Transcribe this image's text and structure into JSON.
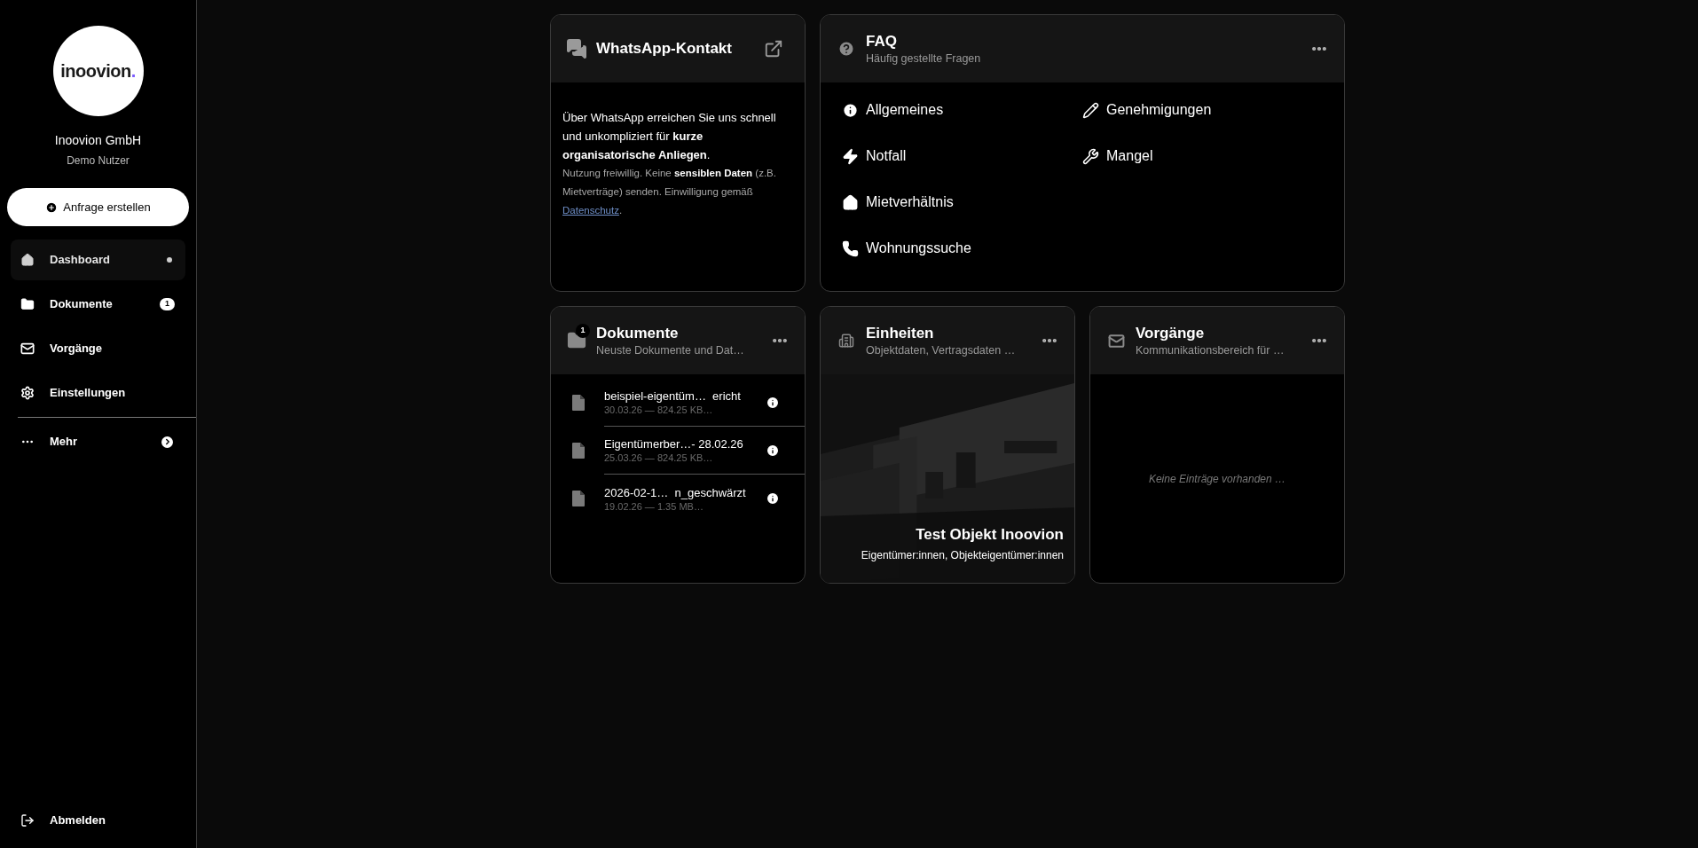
{
  "sidebar": {
    "logo": {
      "text": "inoovion",
      "mark": "."
    },
    "company": "Inoovion GmbH",
    "user": "Demo Nutzer",
    "create_button": "Anfrage erstellen",
    "nav": [
      {
        "kind": "home",
        "label": "Dashboard",
        "selected": true
      },
      {
        "kind": "folder",
        "label": "Dokumente",
        "selected": false,
        "badge": "1"
      },
      {
        "kind": "mail",
        "label": "Vorgänge",
        "selected": false
      },
      {
        "kind": "gear",
        "label": "Einstellungen",
        "selected": false
      }
    ],
    "more": {
      "label": "Mehr"
    },
    "logout": "Abmelden"
  },
  "whatsapp_card": {
    "title": "WhatsApp-Kontakt",
    "text": "Über WhatsApp erreichen Sie uns schnell und unkompliziert für **kurze organisatorische Anliegen**.",
    "note": "Nutzung freiwillig. Keine **sensiblen Daten** (z.B. Mietverträge) senden. Einwilligung gemäß",
    "link": "Datenschutz",
    "after_link": "."
  },
  "faq_card": {
    "title": "FAQ",
    "subtitle": "Häufig gestellte Fragen",
    "items": [
      {
        "kind": "info",
        "label": "Allgemeines"
      },
      {
        "kind": "bolt",
        "label": "Notfall"
      },
      {
        "kind": "home",
        "label": "Mietverhältnis"
      },
      {
        "kind": "phone",
        "label": "Wohnungssuche"
      },
      {
        "kind": "pencil",
        "label": "Genehmigungen"
      },
      {
        "kind": "wrench",
        "label": "Mangel"
      }
    ]
  },
  "documents_card": {
    "title": "Dokumente",
    "subtitle": "Neuste Dokumente und Dat…",
    "badge": "1",
    "rows": [
      {
        "name": "beispiel-eigentüm…  ericht",
        "meta": "30.03.26 — 824.25 KB…"
      },
      {
        "name": "Eigentümerber…- 28.02.26",
        "meta": "25.03.26 — 824.25 KB…"
      },
      {
        "name": "2026-02-1…  n_geschwärzt",
        "meta": "19.02.26 — 1.35 MB…"
      }
    ]
  },
  "units_card": {
    "title": "Einheiten",
    "subtitle": "Objektdaten, Vertragsdaten …",
    "object_name": "Test Objekt Inoovion",
    "roles": "Eigentümer:innen, Objekteigentümer:innen"
  },
  "processes_card": {
    "title": "Vorgänge",
    "subtitle": "Kommunikationsbereich für …",
    "empty_text": "Keine Einträge vorhanden …"
  }
}
